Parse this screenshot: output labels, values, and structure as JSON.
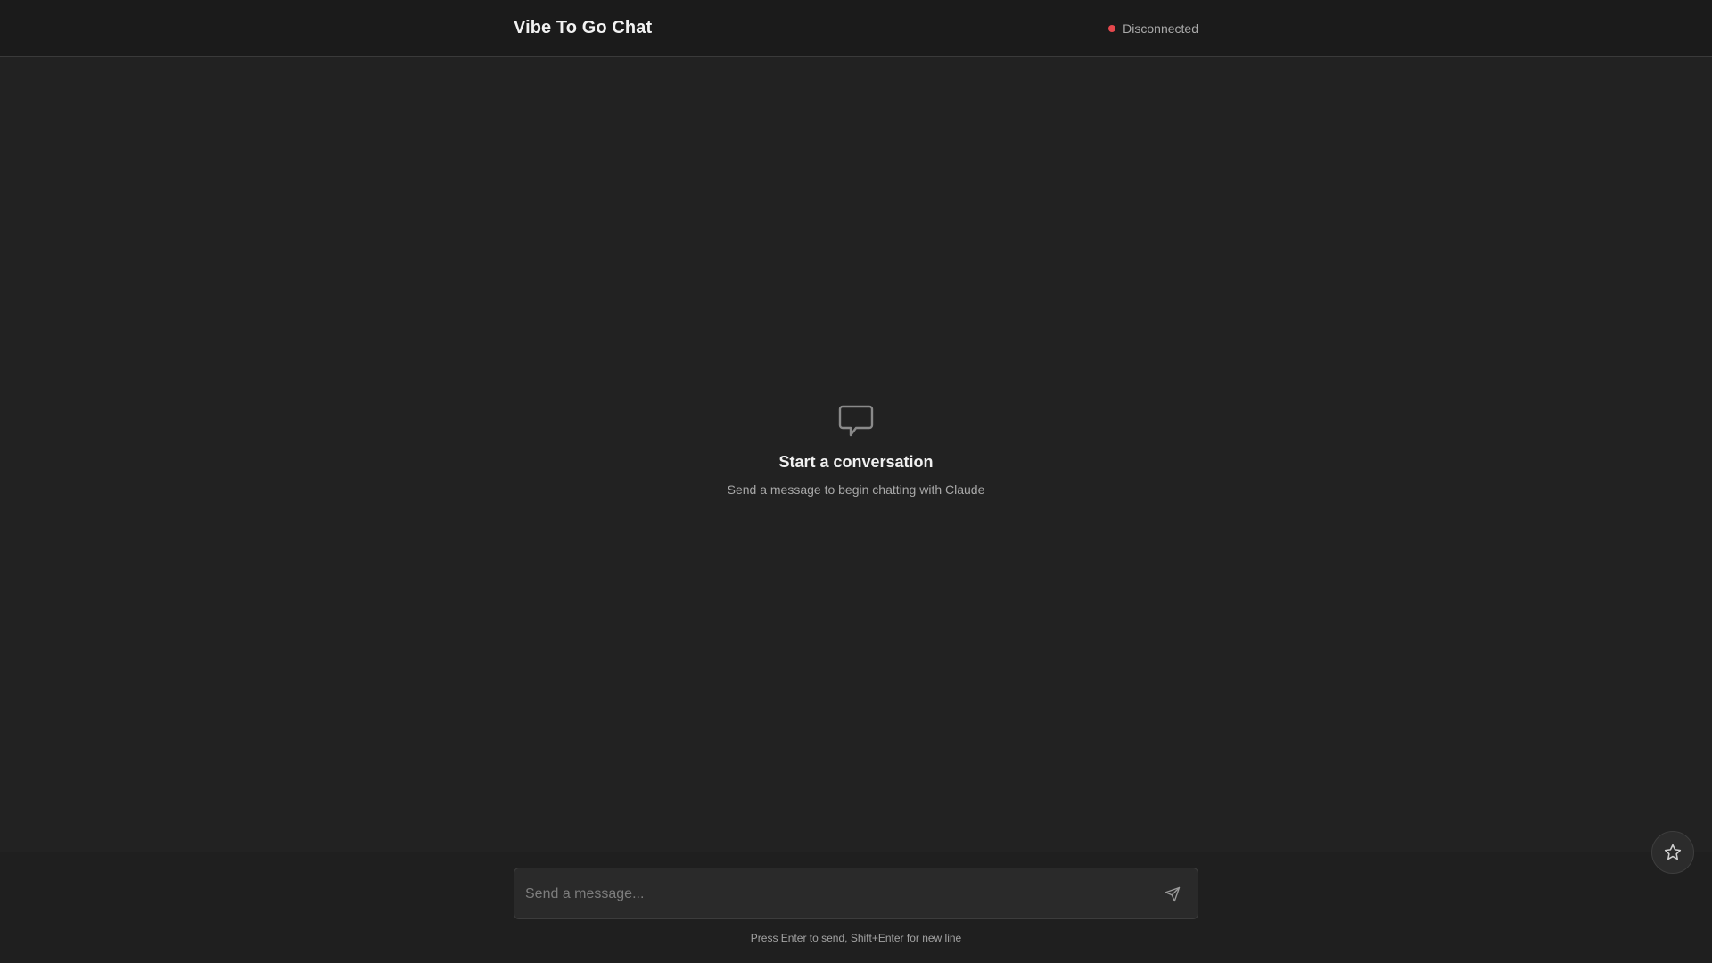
{
  "header": {
    "title": "Vibe To Go Chat",
    "status": {
      "label": "Disconnected",
      "color": "#e5484d"
    }
  },
  "empty_state": {
    "icon": "chat-bubble-icon",
    "title": "Start a conversation",
    "subtitle": "Send a message to begin chatting with Claude"
  },
  "composer": {
    "value": "",
    "placeholder": "Send a message...",
    "send_icon": "send-icon",
    "hint": "Press Enter to send, Shift+Enter for new line"
  },
  "floating_button": {
    "icon": "star-icon"
  }
}
